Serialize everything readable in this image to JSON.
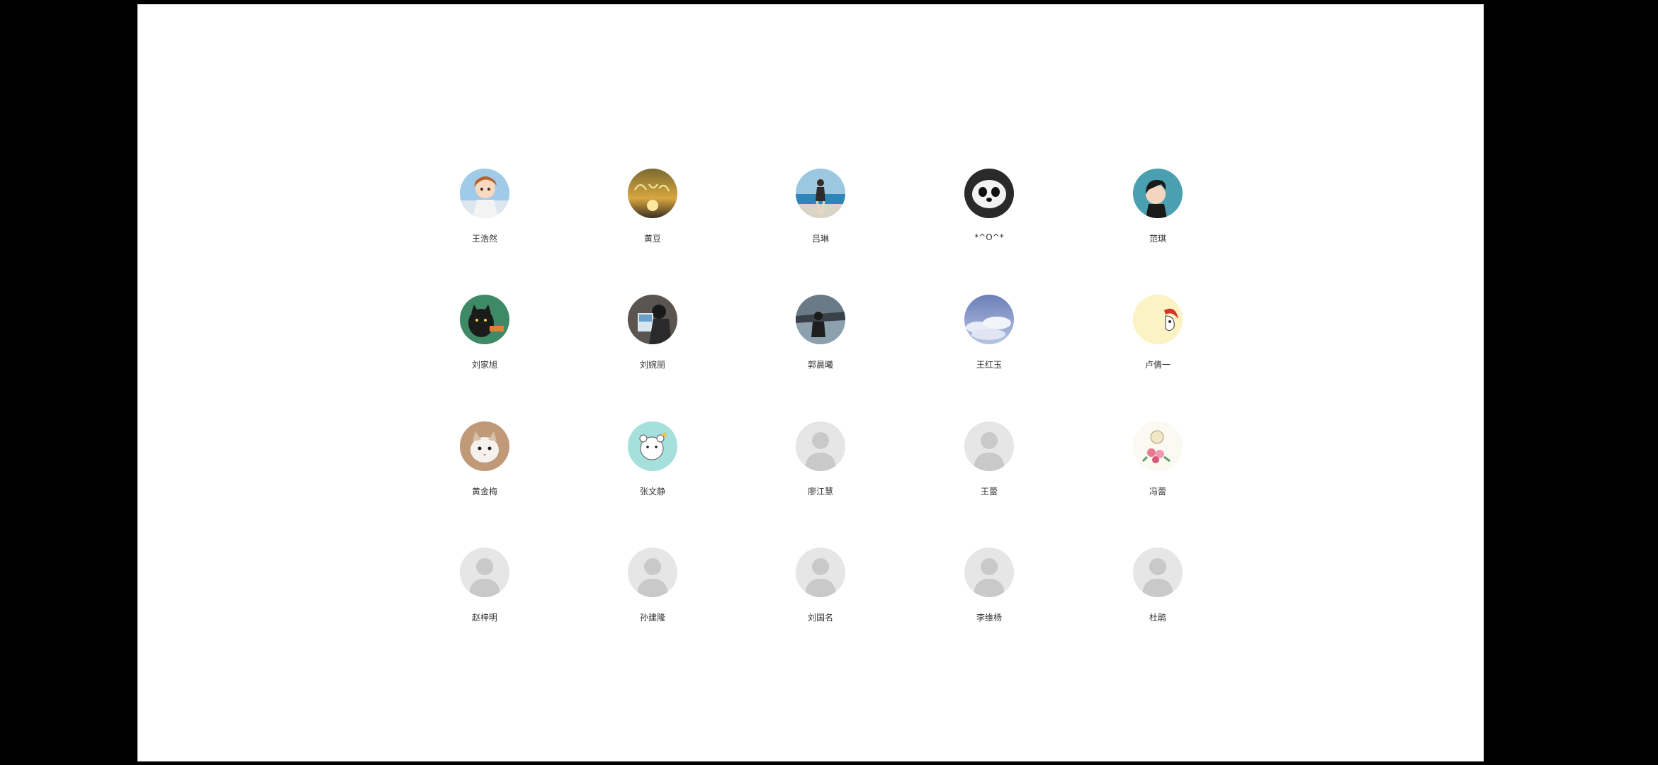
{
  "contacts": [
    {
      "name": "王浩然",
      "avatar": "anime-girl-avatar-icon"
    },
    {
      "name": "黄豆",
      "avatar": "sunset-lettering-avatar-icon"
    },
    {
      "name": "吕琳",
      "avatar": "beach-person-avatar-icon"
    },
    {
      "name": "*^O^*",
      "avatar": "panda-avatar-icon"
    },
    {
      "name": "范琪",
      "avatar": "cartoon-girl-avatar-icon"
    },
    {
      "name": "刘家旭",
      "avatar": "black-cat-avatar-icon"
    },
    {
      "name": "刘婉丽",
      "avatar": "reading-person-avatar-icon"
    },
    {
      "name": "郭晨曦",
      "avatar": "lakeside-person-avatar-icon"
    },
    {
      "name": "王红玉",
      "avatar": "sky-clouds-avatar-icon"
    },
    {
      "name": "卢倩一",
      "avatar": "red-hair-cartoon-avatar-icon"
    },
    {
      "name": "黄金梅",
      "avatar": "cat-avatar-icon"
    },
    {
      "name": "张文静",
      "avatar": "cartoon-bear-avatar-icon"
    },
    {
      "name": "廖江慧",
      "avatar": "default-user-avatar-icon"
    },
    {
      "name": "王蕾",
      "avatar": "default-user-avatar-icon"
    },
    {
      "name": "冯蕾",
      "avatar": "flower-bouquet-avatar-icon"
    },
    {
      "name": "赵梓明",
      "avatar": "default-user-avatar-icon"
    },
    {
      "name": "孙建隆",
      "avatar": "default-user-avatar-icon"
    },
    {
      "name": "刘国名",
      "avatar": "default-user-avatar-icon"
    },
    {
      "name": "李维杨",
      "avatar": "default-user-avatar-icon"
    },
    {
      "name": "杜鹃",
      "avatar": "default-user-avatar-icon"
    }
  ]
}
